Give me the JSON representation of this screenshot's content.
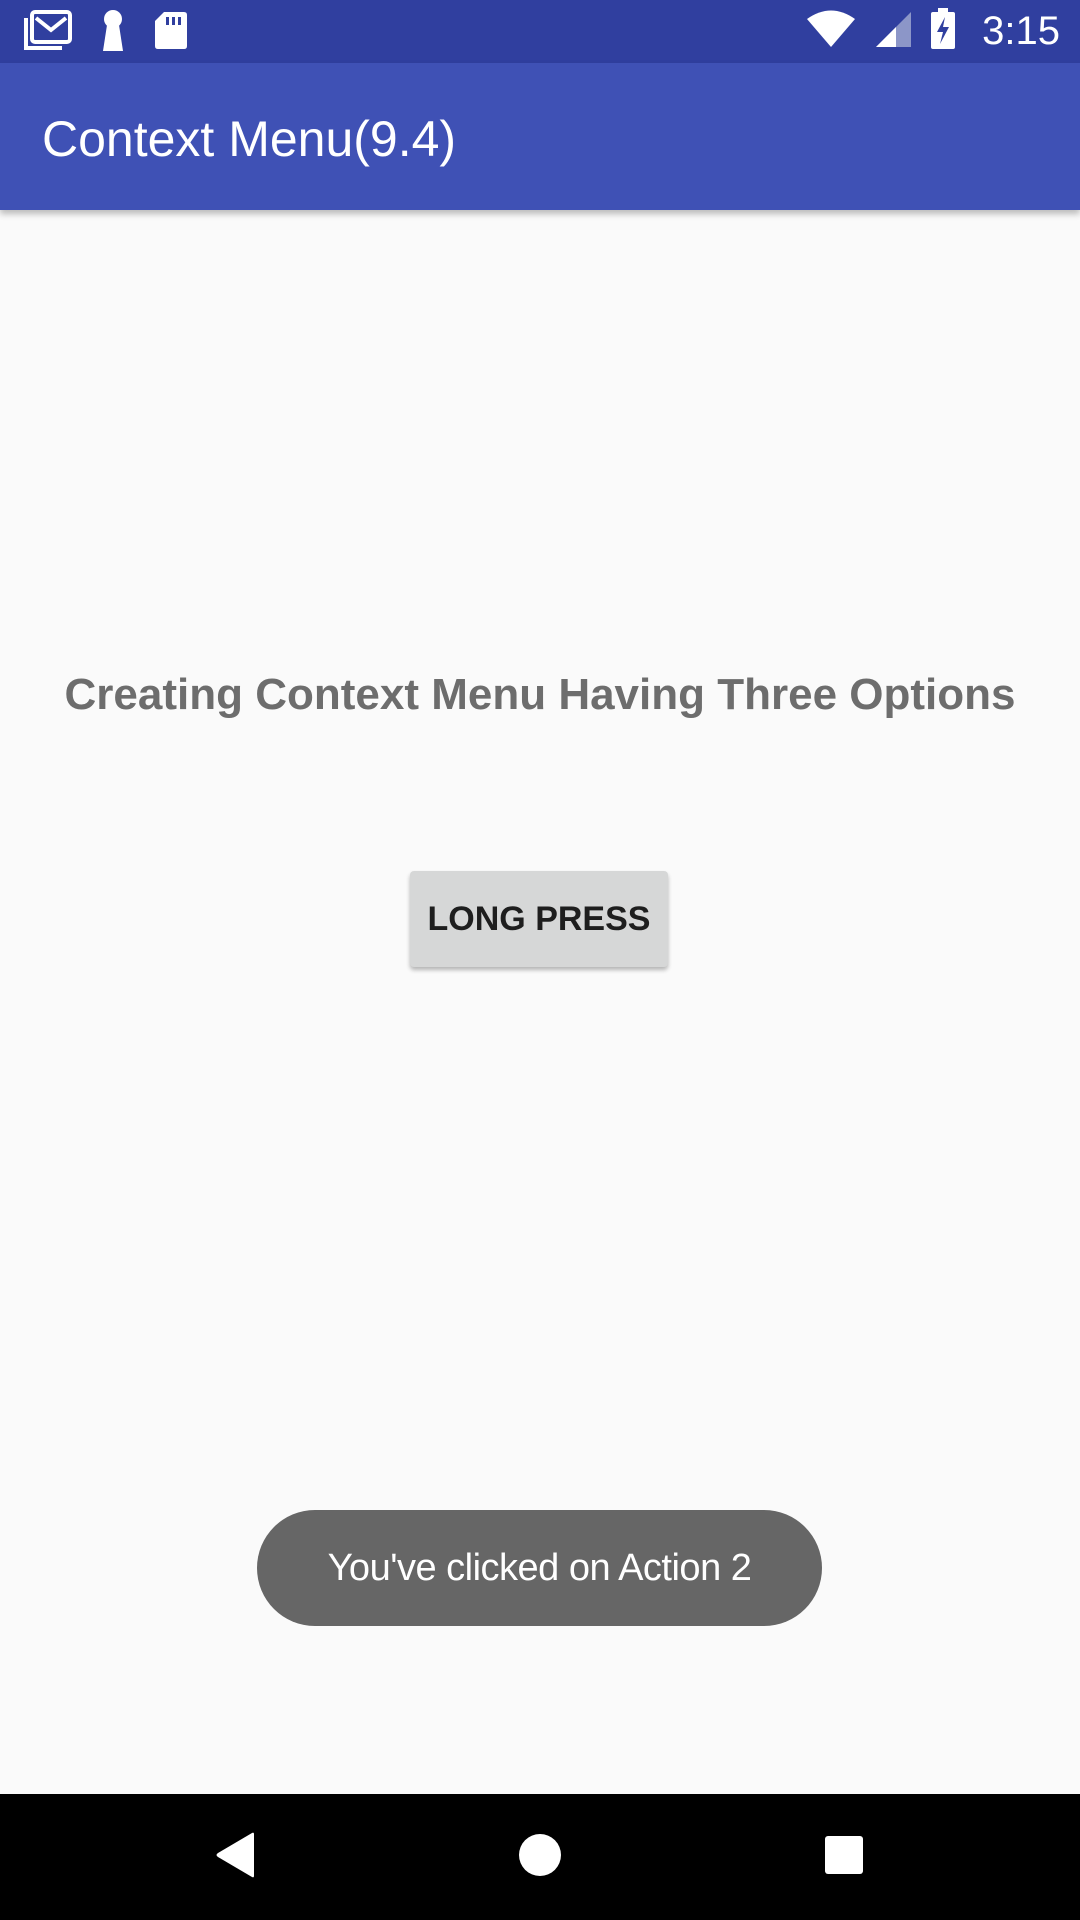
{
  "status_bar": {
    "time": "3:15",
    "icons": [
      "gmail-icon",
      "keyhole-icon",
      "sd-card-icon",
      "wifi-icon",
      "cell-signal-icon",
      "battery-charging-icon"
    ],
    "background_color": "#303f9f"
  },
  "app_bar": {
    "title": "Context Menu(9.4)",
    "background_color": "#3f51b5"
  },
  "main": {
    "heading": "Creating Context Menu Having Three Options",
    "button_label": "LONG PRESS"
  },
  "toast": {
    "message": "You've clicked on Action 2"
  },
  "nav_bar": {
    "buttons": [
      "back-icon",
      "home-icon",
      "recents-icon"
    ]
  }
}
